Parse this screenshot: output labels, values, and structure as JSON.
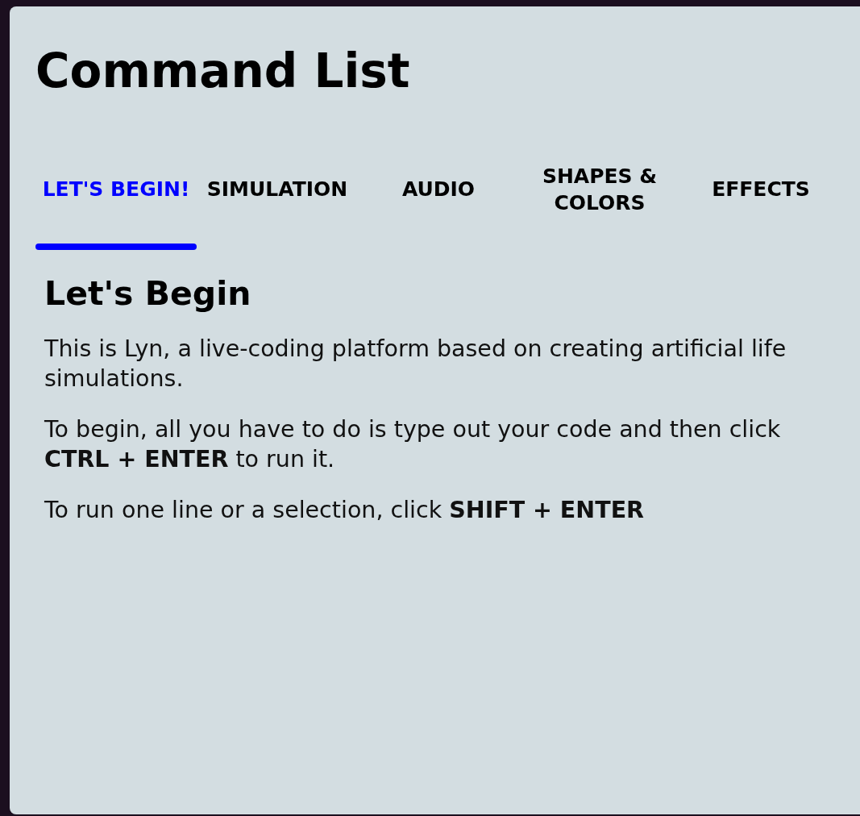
{
  "title": "Command List",
  "tabs": [
    {
      "label": "LET'S BEGIN!",
      "selected": true
    },
    {
      "label": "SIMULATION",
      "selected": false
    },
    {
      "label": "AUDIO",
      "selected": false
    },
    {
      "label": "SHAPES & COLORS",
      "selected": false
    },
    {
      "label": "EFFECTS",
      "selected": false
    }
  ],
  "section": {
    "heading": "Let's Begin",
    "paragraphs": [
      "This is Lyn, a live-coding platform based on creating artificial life simulations.",
      "To begin, all you have to do is type out your code and then click **CTRL + ENTER** to run it.",
      "To run one line or a selection, click **SHIFT + ENTER**"
    ]
  }
}
